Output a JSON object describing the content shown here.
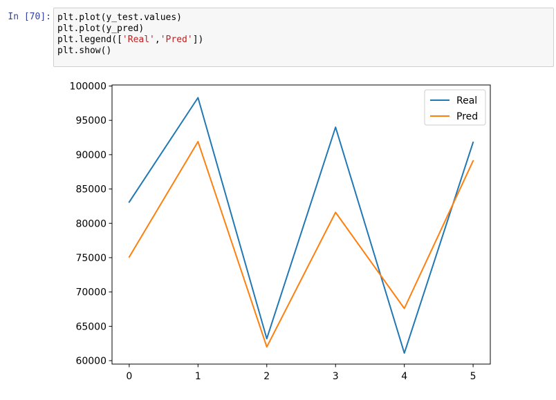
{
  "cell": {
    "prompt": "In [70]:",
    "code_lines": [
      {
        "parts": [
          {
            "text": "plt.plot(y_test.values)",
            "kind": "code"
          }
        ]
      },
      {
        "parts": [
          {
            "text": "plt.plot(y_pred)",
            "kind": "code"
          }
        ]
      },
      {
        "parts": [
          {
            "text": "plt.legend([",
            "kind": "code"
          },
          {
            "text": "'Real'",
            "kind": "str"
          },
          {
            "text": ",",
            "kind": "code"
          },
          {
            "text": "'Pred'",
            "kind": "str"
          },
          {
            "text": "])",
            "kind": "code"
          }
        ]
      },
      {
        "parts": [
          {
            "text": "plt.show()",
            "kind": "code"
          }
        ]
      }
    ]
  },
  "chart_data": {
    "type": "line",
    "x": [
      0,
      1,
      2,
      3,
      4,
      5
    ],
    "xticks": [
      "0",
      "1",
      "2",
      "3",
      "4",
      "5"
    ],
    "yticks": [
      "60000",
      "65000",
      "70000",
      "75000",
      "80000",
      "85000",
      "90000",
      "95000",
      "100000"
    ],
    "ytick_values": [
      60000,
      65000,
      70000,
      75000,
      80000,
      85000,
      90000,
      95000,
      100000
    ],
    "xlim": [
      -0.25,
      5.25
    ],
    "ylim": [
      59500,
      100150
    ],
    "grid": false,
    "legend_position": "top-right",
    "series": [
      {
        "name": "Real",
        "color": "#1f77b4",
        "values": [
          83100,
          98300,
          63200,
          94000,
          61100,
          91800
        ]
      },
      {
        "name": "Pred",
        "color": "#ff7f0e",
        "values": [
          75100,
          91900,
          62000,
          81600,
          67600,
          89100
        ]
      }
    ]
  }
}
